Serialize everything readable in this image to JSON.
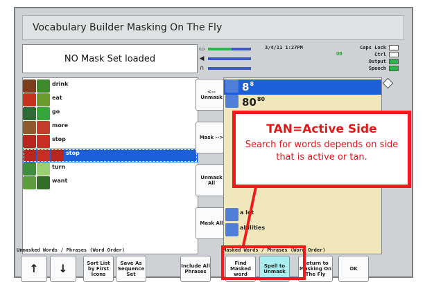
{
  "title": "Vocabulary Builder Masking On The Fly",
  "status_text": "NO Mask Set loaded",
  "datetime": "3/4/11 1:27PM",
  "indicators": {
    "ub_label": "UB",
    "caps_lock": "Caps Lock",
    "ctrl": "Ctrl",
    "output": "Output",
    "speech": "Speech"
  },
  "left_list": [
    {
      "label": "drink",
      "colors": [
        "#7a3e1c",
        "#3f8a2b"
      ]
    },
    {
      "label": "eat",
      "colors": [
        "#c4341f",
        "#6b9a2d"
      ]
    },
    {
      "label": "go",
      "colors": [
        "#2d6a35",
        "#36a63c"
      ]
    },
    {
      "label": "more",
      "colors": [
        "#8f5a2c",
        "#c23b2b"
      ]
    },
    {
      "label": "stop",
      "colors": [
        "#b8261f",
        "#c62e24"
      ]
    },
    {
      "label": "stop",
      "colors": [
        "#b8261f",
        "#c62e24",
        "#b8261f"
      ],
      "selected": true
    },
    {
      "label": "turn",
      "colors": [
        "#3e8e3b",
        "#9ad06f"
      ]
    },
    {
      "label": "want",
      "colors": [
        "#5e9d3d",
        "#326d2b"
      ]
    }
  ],
  "mid_buttons": {
    "unmask": "<-- Unmask",
    "mask": "Mask -->",
    "unmask_all": "Unmask All",
    "mask_all": "Mask All"
  },
  "right_list": [
    {
      "big": "8",
      "small": "8",
      "selected": true
    },
    {
      "big": "80",
      "small": "80"
    },
    {
      "big": "",
      "small": "a lot"
    },
    {
      "big": "",
      "small": "abilities"
    }
  ],
  "callout": {
    "heading": "TAN=Active Side",
    "body": "Search for words depends on side that is active or tan."
  },
  "labels": {
    "unmasked": "Unmasked Words / Phrases (Word Order)",
    "masked": "Masked Words / Phrases (Word Order)"
  },
  "bottom_buttons": {
    "up": "↑",
    "down": "↓",
    "sort": "Sort List by First Icons",
    "save": "Save As Sequence Set",
    "include": "Include All Phrases",
    "find": "Find Masked word",
    "spell": "Spell to Unmask",
    "return": "Return to Masking On The Fly",
    "ok": "OK"
  }
}
